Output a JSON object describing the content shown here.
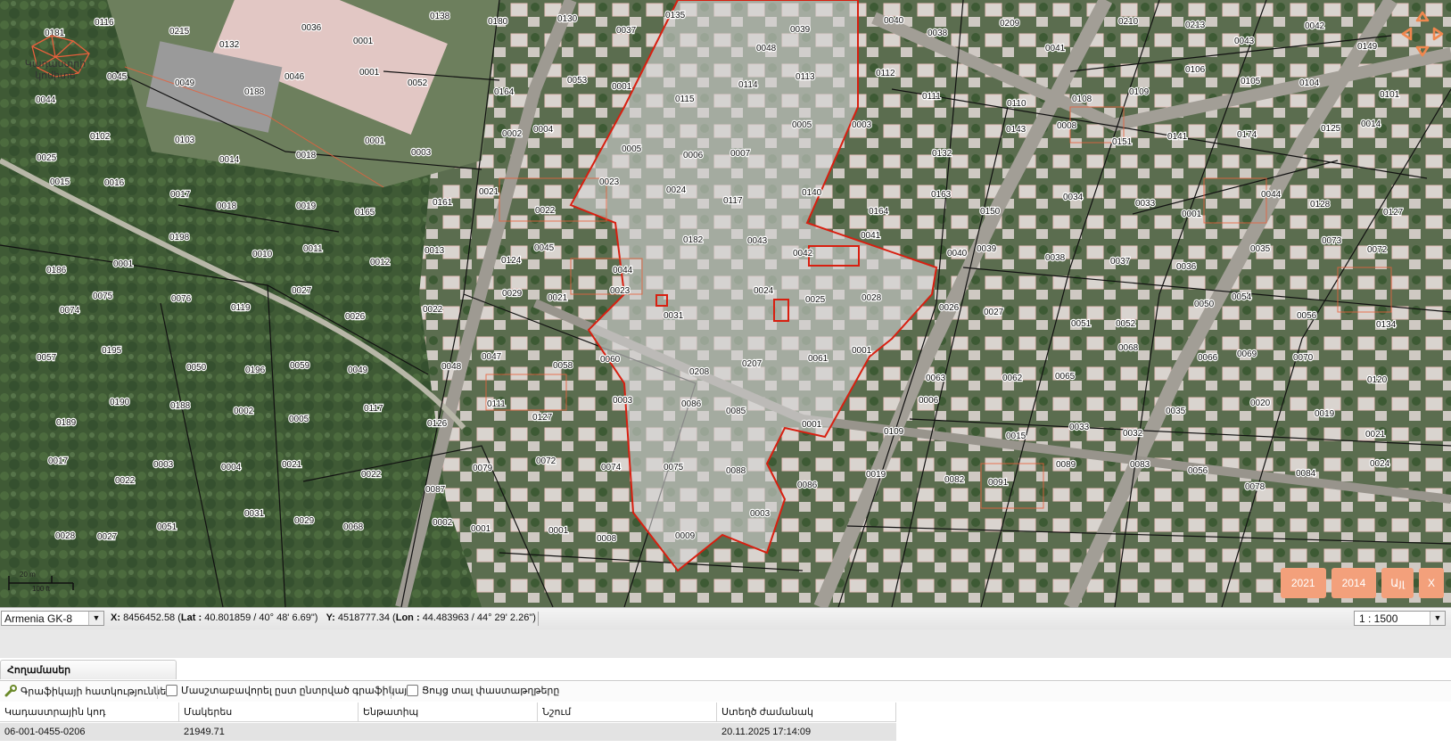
{
  "logo": {
    "text": "Կադաստրի\nկոմիտե"
  },
  "map": {
    "parcel_labels": [
      "0181",
      "0116",
      "0215",
      "0132",
      "0036",
      "0001",
      "0138",
      "0180",
      "0130",
      "0037",
      "0135",
      "0048",
      "0039",
      "0040",
      "0038",
      "0209",
      "0041",
      "0210",
      "0213",
      "0043",
      "0042",
      "0149",
      "0044",
      "0045",
      "0049",
      "0188",
      "0046",
      "0001",
      "0052",
      "0164",
      "0053",
      "0001",
      "0115",
      "0114",
      "0113",
      "0112",
      "0111",
      "0110",
      "0108",
      "0109",
      "0106",
      "0105",
      "0104",
      "0101",
      "0025",
      "0102",
      "0103",
      "0014",
      "0018",
      "0001",
      "0003",
      "0002",
      "0004",
      "0005",
      "0006",
      "0007",
      "0005",
      "0003",
      "0132",
      "0143",
      "0008",
      "0151",
      "0141",
      "0174",
      "0125",
      "0014",
      "0015",
      "0016",
      "0017",
      "0018",
      "0019",
      "0165",
      "0161",
      "0021",
      "0022",
      "0023",
      "0024",
      "0117",
      "0140",
      "0164",
      "0163",
      "0150",
      "0034",
      "0033",
      "0001",
      "0044",
      "0128",
      "0127",
      "0186",
      "0001",
      "0198",
      "0010",
      "0011",
      "0012",
      "0013",
      "0124",
      "0045",
      "0044",
      "0182",
      "0043",
      "0042",
      "0041",
      "0040",
      "0039",
      "0038",
      "0037",
      "0036",
      "0035",
      "0073",
      "0072",
      "0074",
      "0075",
      "0076",
      "0119",
      "0027",
      "0026",
      "0022",
      "0029",
      "0021",
      "0023",
      "0031",
      "0024",
      "0025",
      "0028",
      "0026",
      "0027",
      "0051",
      "0052",
      "0050",
      "0054",
      "0056",
      "0134",
      "0057",
      "0195",
      "0050",
      "0196",
      "0059",
      "0049",
      "0048",
      "0047",
      "0058",
      "0060",
      "0208",
      "0207",
      "0061",
      "0001",
      "0063",
      "0062",
      "0065",
      "0068",
      "0066",
      "0069",
      "0070",
      "0120",
      "0189",
      "0190",
      "0188",
      "0002",
      "0005",
      "0117",
      "0126",
      "0111",
      "0127",
      "0003",
      "0086",
      "0085",
      "0001",
      "0109",
      "0006",
      "0015",
      "0033",
      "0032",
      "0035",
      "0020",
      "0019",
      "0021",
      "0017",
      "0022",
      "0003",
      "0004",
      "0021",
      "0022",
      "0087",
      "0079",
      "0072",
      "0074",
      "0075",
      "0088",
      "0086",
      "0019",
      "0082",
      "0091",
      "0089",
      "0083",
      "0056",
      "0078",
      "0084",
      "0024",
      "0028",
      "0027",
      "0051",
      "0031",
      "0029",
      "0068",
      "0002",
      "0001",
      "0001",
      "0008",
      "0009",
      "0003"
    ]
  },
  "nav": {
    "icon": "pan-arrows-icon"
  },
  "year_buttons": [
    "2021",
    "2014",
    "Այլ",
    "X"
  ],
  "scalebar": {
    "top_label": "20 m",
    "bottom_label": "100 ft"
  },
  "statusbar": {
    "crs": "Armenia GK-8",
    "x_label": "X:",
    "x_value": "8456452.58",
    "lat_label": "Lat :",
    "lat_value": "40.801859 / 40° 48' 6.69\"",
    "y_label": "Y:",
    "y_value": "4518777.34",
    "lon_label": "Lon :",
    "lon_value": "44.483963 / 44° 29' 2.26\"",
    "scale": "1 : 1500"
  },
  "panel": {
    "tab": "Հողամասեր",
    "toolbar": {
      "graphic_props": "Գրաֆիկայի հատկություններ",
      "scale_to_selected": "Մասշտաբավորել ըստ ընտրված գրաֆիկայի",
      "show_docs": "Ցույց տալ փաստաթղթերը"
    },
    "columns": [
      "Կադաստրային կոդ",
      "Մակերես",
      "Ենթատիպ",
      "Նշում",
      "Ստեղծ ժամանակ"
    ],
    "rows": [
      [
        "06-001-0455-0206",
        "21949.71",
        "",
        "",
        "20.11.2025 17:14:09"
      ]
    ]
  },
  "colors": {
    "accent": "#f3a07b",
    "parcel_highlight": "#d81f10",
    "selection": "#e3e3e3"
  }
}
